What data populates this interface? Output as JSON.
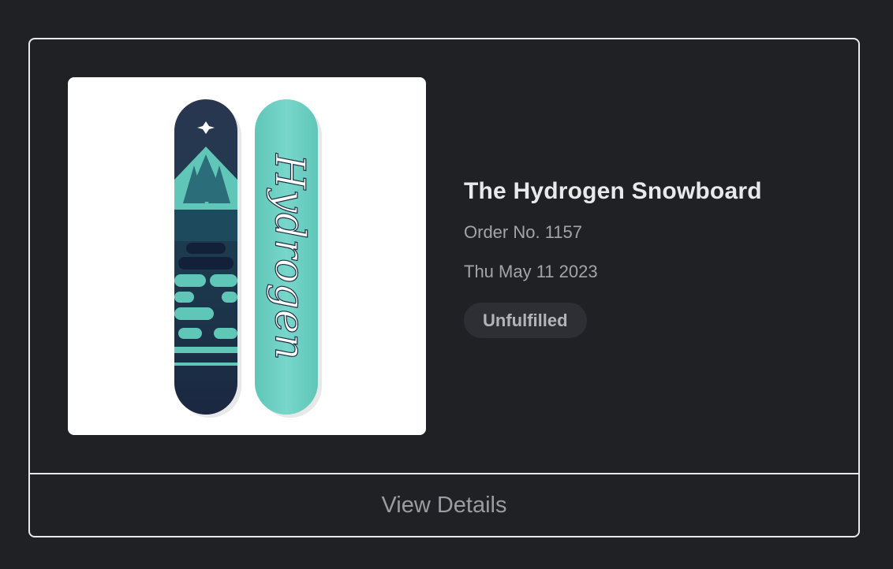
{
  "order": {
    "product_title": "The Hydrogen Snowboard",
    "order_number": "Order No. 1157",
    "date": "Thu May 11 2023",
    "status": "Unfulfilled",
    "image_icon": "snowboard-product-image",
    "image_text": "Hydrogen"
  },
  "actions": {
    "view_details_label": "View Details"
  },
  "colors": {
    "background": "#202125",
    "border": "#e9e9eb",
    "title": "#e9e9eb",
    "meta": "#a4a4a8",
    "badge_bg": "#2e2f34",
    "board_navy": "#1f2b44",
    "board_teal": "#6fd1c4"
  }
}
